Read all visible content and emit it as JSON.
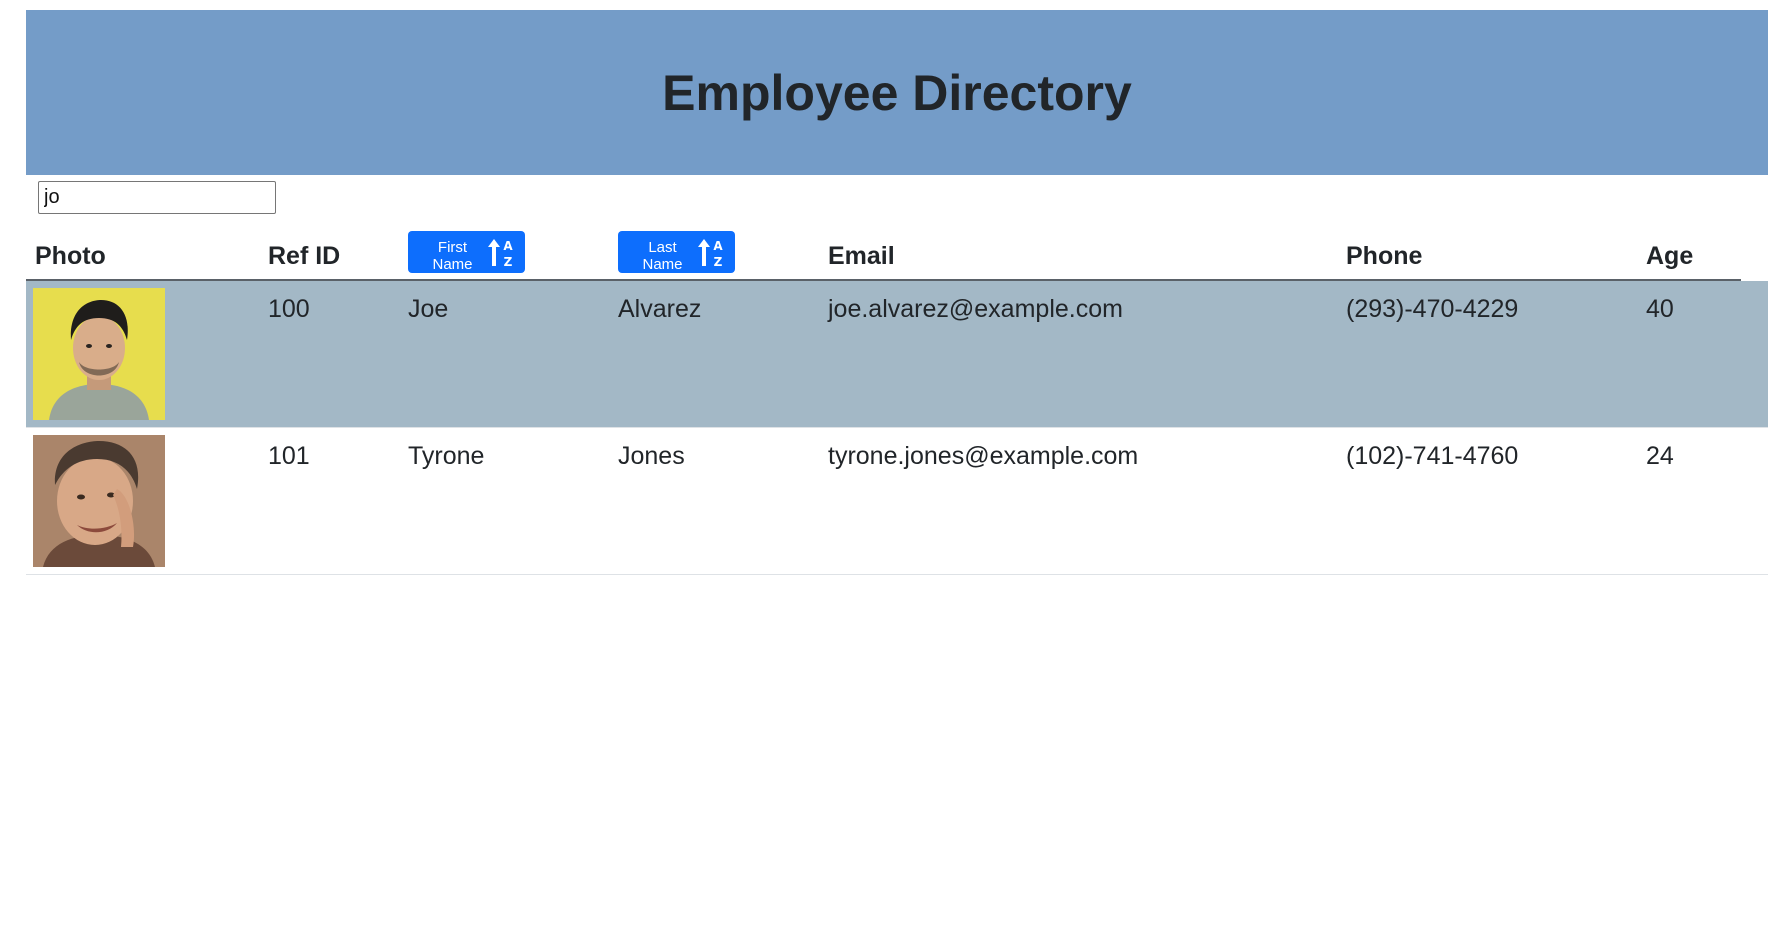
{
  "header": {
    "title": "Employee Directory"
  },
  "search": {
    "value": "jo"
  },
  "table": {
    "columns": {
      "photo": "Photo",
      "ref_id": "Ref ID",
      "first_name": "First Name",
      "last_name": "Last Name",
      "email": "Email",
      "phone": "Phone",
      "age": "Age"
    },
    "sort_icon": "sort-alpha-up-icon",
    "rows": [
      {
        "ref_id": "100",
        "first_name": "Joe",
        "last_name": "Alvarez",
        "email": "joe.alvarez@example.com",
        "phone": "(293)-470-4229",
        "age": "40",
        "highlighted": true
      },
      {
        "ref_id": "101",
        "first_name": "Tyrone",
        "last_name": "Jones",
        "email": "tyrone.jones@example.com",
        "phone": "(102)-741-4760",
        "age": "24",
        "highlighted": false
      }
    ]
  },
  "colors": {
    "banner": "#749cc8",
    "sort_button": "#0d6efd",
    "row_highlight": "#a3b8c6"
  }
}
